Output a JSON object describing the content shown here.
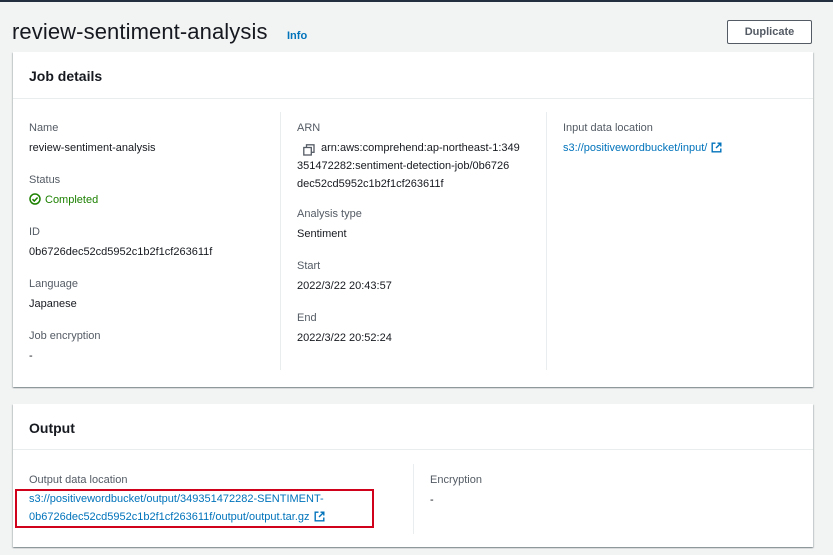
{
  "header": {
    "title": "review-sentiment-analysis",
    "info_label": "Info",
    "duplicate_label": "Duplicate"
  },
  "job_details": {
    "title": "Job details",
    "name_label": "Name",
    "name_value": "review-sentiment-analysis",
    "status_label": "Status",
    "status_value": "Completed",
    "id_label": "ID",
    "id_value": "0b6726dec52cd5952c1b2f1cf263611f",
    "language_label": "Language",
    "language_value": "Japanese",
    "encryption_label": "Job encryption",
    "encryption_value": "-",
    "arn_label": "ARN",
    "arn_line1": "arn:aws:comprehend:ap-northeast-1:349",
    "arn_line2": "351472282:sentiment-detection-job/0b6726",
    "arn_line3": "dec52cd5952c1b2f1cf263611f",
    "analysis_type_label": "Analysis type",
    "analysis_type_value": "Sentiment",
    "start_label": "Start",
    "start_value": "2022/3/22 20:43:57",
    "end_label": "End",
    "end_value": "2022/3/22 20:52:24",
    "input_label": "Input data location",
    "input_value": "s3://positivewordbucket/input/"
  },
  "output": {
    "title": "Output",
    "location_label": "Output data location",
    "location_line1": "s3://positivewordbucket/output/349351472282-SENTIMENT-",
    "location_line2": "0b6726dec52cd5952c1b2f1cf263611f/output/output.tar.gz",
    "encryption_label": "Encryption",
    "encryption_value": "-"
  },
  "colors": {
    "link": "#0073bb",
    "success": "#1d8102",
    "highlight": "#d0021b"
  },
  "icons": [
    "copy-icon",
    "external-link-icon",
    "status-success-icon"
  ]
}
